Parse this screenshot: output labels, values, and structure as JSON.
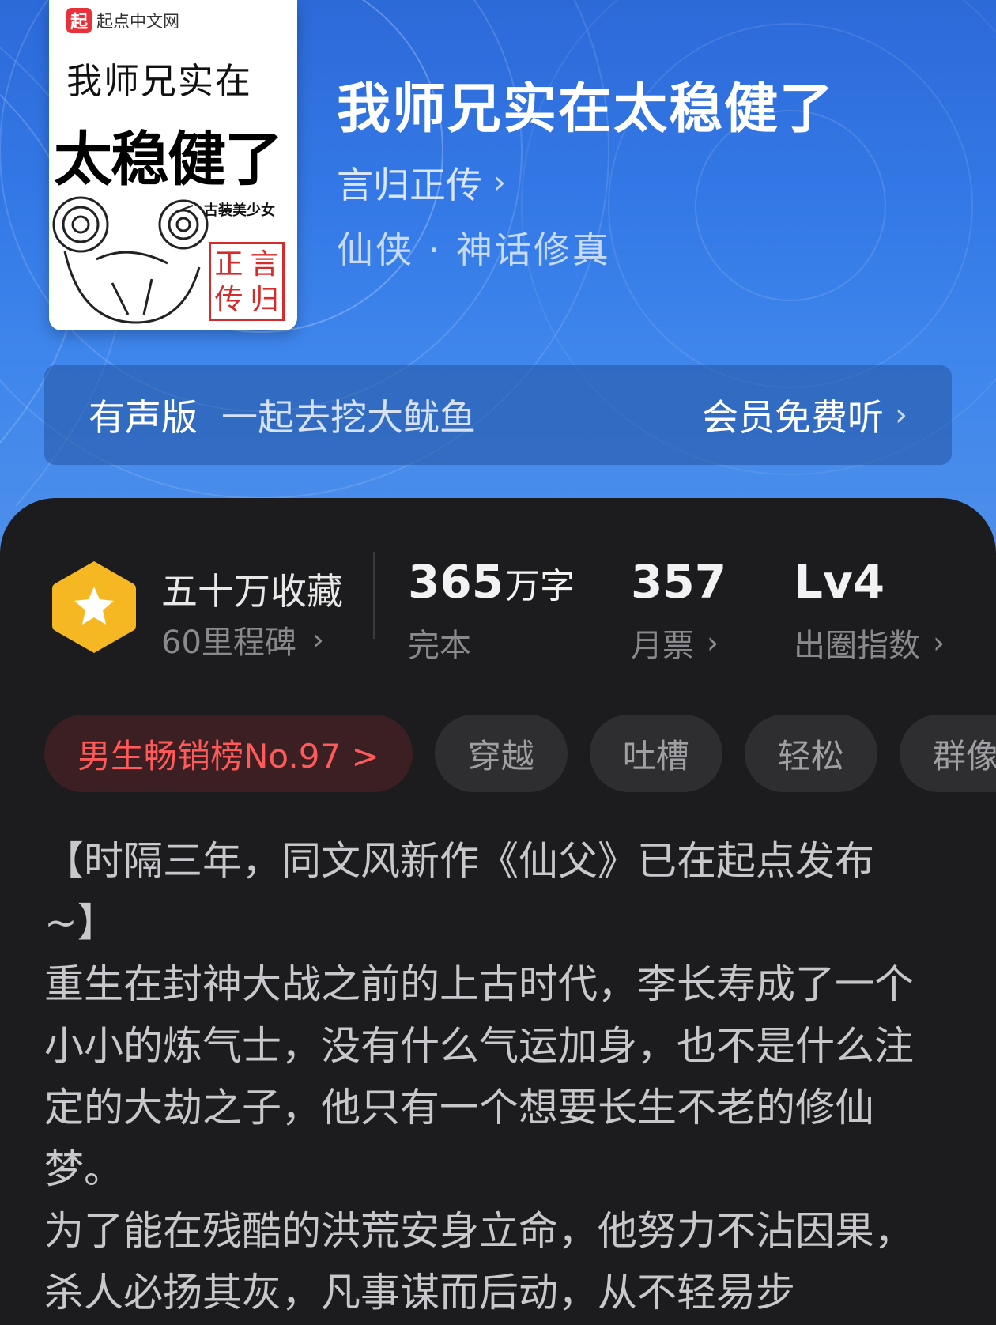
{
  "cover": {
    "logo_badge": "起",
    "logo_text": "起点中文网",
    "line1": "我师兄实在",
    "line2": "太稳健了",
    "subtitle": "古装美少女",
    "seal": [
      "言",
      "正",
      "归",
      "传"
    ]
  },
  "book": {
    "title": "我师兄实在太稳健了",
    "author": "言归正传",
    "genre": "仙侠 · 神话修真"
  },
  "audio": {
    "label": "有声版",
    "narrator": "一起去挖大鱿鱼",
    "cta": "会员免费听"
  },
  "stats": {
    "collect_main": "五十万收藏",
    "collect_sub": "60里程碑",
    "words_value": "365",
    "words_unit": "万字",
    "words_sub": "完本",
    "tickets_value": "357",
    "tickets_sub": "月票",
    "level_value": "Lv4",
    "level_sub": "出圈指数"
  },
  "tags": {
    "rank": "男生畅销榜No.97 >",
    "items": [
      "穿越",
      "吐槽",
      "轻松",
      "群像"
    ]
  },
  "description": "【时隔三年，同文风新作《仙父》已在起点发布~】\n重生在封神大战之前的上古时代，李长寿成了一个小小的炼气士，没有什么气运加身，也不是什么注定的大劫之子，他只有一个想要长生不老的修仙梦。\n为了能在残酷的洪荒安身立命，他努力不沾因果，杀人必扬其灰，凡事谋而后动，从不轻易步",
  "colors": {
    "hero_blue": "#3378e6",
    "panel_bg": "#1c1c1e",
    "rank_text": "#ff5a5a",
    "badge_gold": "#f5b823"
  },
  "icons": {
    "badge": "hexagon-star-icon",
    "chevron": "chevron-right-icon"
  }
}
